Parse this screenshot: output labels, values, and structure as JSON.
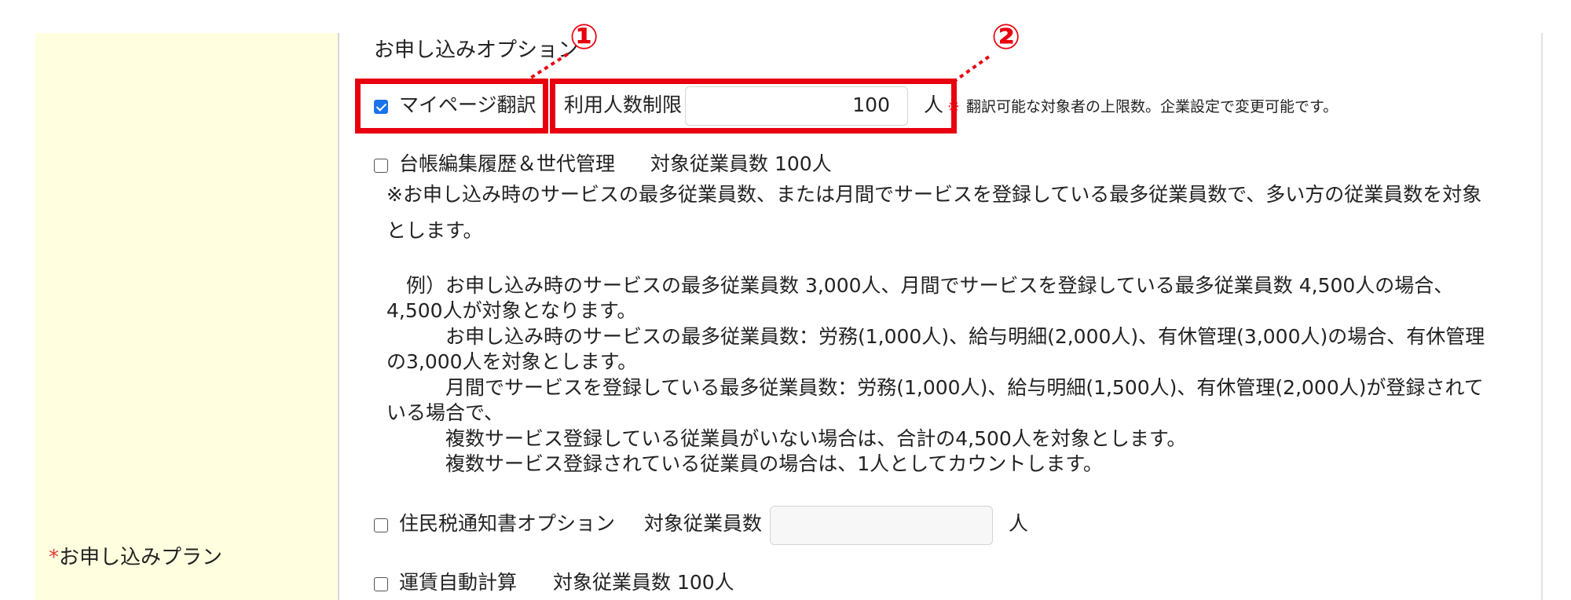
{
  "left": {
    "plan_label": "お申し込みプラン",
    "required_mark": "*"
  },
  "options_header": "お申し込みオプション",
  "annotations": {
    "marker_1": "①",
    "marker_2": "②",
    "highlight_color": "#e8000f"
  },
  "mypage_translation": {
    "checked": true,
    "label": "マイページ翻訳",
    "limit_label": "利用人数制限",
    "limit_value": "100",
    "unit": "人",
    "note_mark": "※",
    "note": "翻訳可能な対象者の上限数。企業設定で変更可能です。"
  },
  "ledger": {
    "checked": false,
    "label": "台帳編集履歴＆世代管理",
    "count_text": "対象従業員数 100人",
    "desc_line1": "※お申し込み時のサービスの最多従業員数、または月間でサービスを登録している最多従業員数で、多い方の従業員数を対象",
    "desc_line2": "とします。",
    "example_lines": [
      "　例）お申し込み時のサービスの最多従業員数 3,000人、月間でサービスを登録している最多従業員数 4,500人の場合、",
      "4,500人が対象となります。",
      "　　　お申し込み時のサービスの最多従業員数：労務(1,000人)、給与明細(2,000人)、有休管理(3,000人)の場合、有休管理",
      "の3,000人を対象とします。",
      "　　　月間でサービスを登録している最多従業員数：労務(1,000人)、給与明細(1,500人)、有休管理(2,000人)が登録されて",
      "いる場合で、",
      "　　　複数サービス登録している従業員がいない場合は、合計の4,500人を対象とします。",
      "　　　複数サービス登録されている従業員の場合は、1人としてカウントします。"
    ]
  },
  "resident_tax": {
    "checked": false,
    "label": "住民税通知書オプション",
    "count_label": "対象従業員数",
    "value": "",
    "unit": "人"
  },
  "fare_calc": {
    "checked": false,
    "label": "運賃自動計算",
    "count_text": "対象従業員数 100人"
  }
}
